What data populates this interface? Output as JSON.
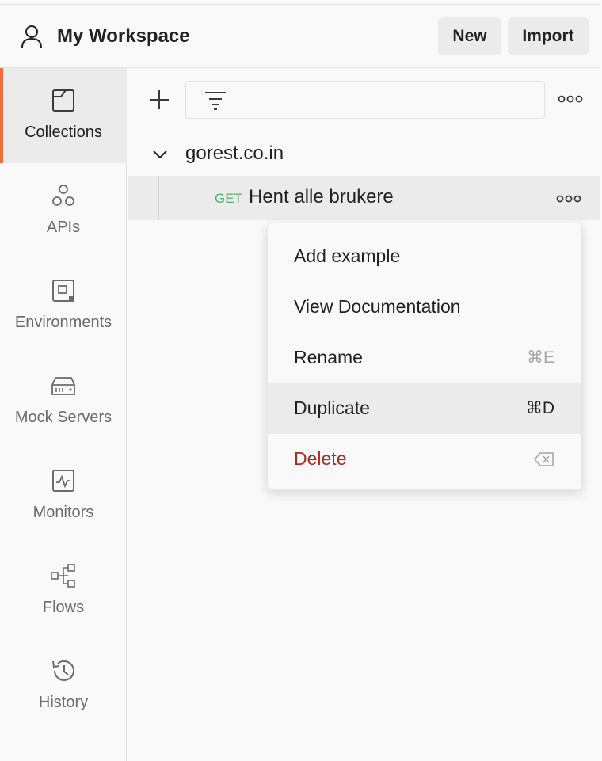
{
  "header": {
    "workspace_title": "My Workspace",
    "new_label": "New",
    "import_label": "Import"
  },
  "sidebar": {
    "items": [
      {
        "label": "Collections",
        "icon": "collections-icon",
        "active": true
      },
      {
        "label": "APIs",
        "icon": "apis-icon",
        "active": false
      },
      {
        "label": "Environments",
        "icon": "environments-icon",
        "active": false
      },
      {
        "label": "Mock Servers",
        "icon": "mock-servers-icon",
        "active": false
      },
      {
        "label": "Monitors",
        "icon": "monitors-icon",
        "active": false
      },
      {
        "label": "Flows",
        "icon": "flows-icon",
        "active": false
      },
      {
        "label": "History",
        "icon": "history-icon",
        "active": false
      }
    ]
  },
  "collections": {
    "filter_placeholder": "",
    "collection_name": "gorest.co.in",
    "request": {
      "method": "GET",
      "name": "Hent alle brukere"
    }
  },
  "context_menu": {
    "items": [
      {
        "label": "Add example",
        "shortcut": ""
      },
      {
        "label": "View Documentation",
        "shortcut": ""
      },
      {
        "label": "Rename",
        "shortcut": "⌘E"
      },
      {
        "label": "Duplicate",
        "shortcut": "⌘D",
        "highlighted": true
      },
      {
        "label": "Delete",
        "shortcut_icon": "backspace-icon",
        "danger": true
      }
    ]
  },
  "colors": {
    "accent": "#f26b3a",
    "get_method": "#4caf6a",
    "danger": "#a82c24"
  }
}
